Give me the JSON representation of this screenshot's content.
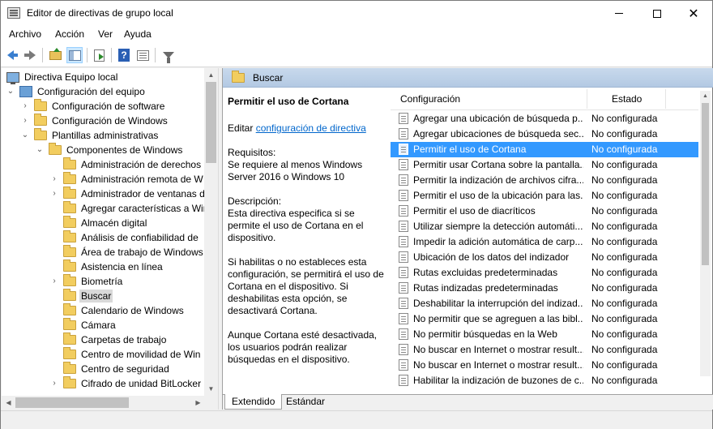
{
  "window": {
    "title": "Editor de directivas de grupo local",
    "controls": [
      "min",
      "max",
      "close"
    ]
  },
  "menu": [
    "Archivo",
    "Acción",
    "Ver",
    "Ayuda"
  ],
  "toolbar": {
    "icons": [
      "back-arrow-icon",
      "forward-arrow-icon",
      "folder-up-icon",
      "show-hide-tree-icon",
      "export-list-icon",
      "help-icon",
      "properties-icon",
      "filter-icon"
    ]
  },
  "tree": {
    "items": [
      {
        "label": "Directiva Equipo local",
        "level": 0,
        "icon": "computer-policy-icon",
        "expander": ""
      },
      {
        "label": "Configuración del equipo",
        "level": 1,
        "icon": "computer-icon",
        "expander": "open"
      },
      {
        "label": "Configuración de software",
        "level": 2,
        "icon": "folder-icon",
        "expander": "closed"
      },
      {
        "label": "Configuración de Windows",
        "level": 2,
        "icon": "folder-icon",
        "expander": "closed"
      },
      {
        "label": "Plantillas administrativas",
        "level": 2,
        "icon": "folder-icon",
        "expander": "open"
      },
      {
        "label": "Componentes de Windows",
        "level": 3,
        "icon": "folder-icon",
        "expander": "open"
      },
      {
        "label": "Administración de derechos",
        "level": 4,
        "icon": "folder-icon",
        "expander": ""
      },
      {
        "label": "Administración remota de W",
        "level": 4,
        "icon": "folder-icon",
        "expander": "closed"
      },
      {
        "label": "Administrador de ventanas d",
        "level": 4,
        "icon": "folder-icon",
        "expander": "closed"
      },
      {
        "label": "Agregar características a Win",
        "level": 4,
        "icon": "folder-icon",
        "expander": ""
      },
      {
        "label": "Almacén digital",
        "level": 4,
        "icon": "folder-icon",
        "expander": ""
      },
      {
        "label": "Análisis de confiabilidad de",
        "level": 4,
        "icon": "folder-icon",
        "expander": ""
      },
      {
        "label": "Área de trabajo de Windows",
        "level": 4,
        "icon": "folder-icon",
        "expander": ""
      },
      {
        "label": "Asistencia en línea",
        "level": 4,
        "icon": "folder-icon",
        "expander": ""
      },
      {
        "label": "Biometría",
        "level": 4,
        "icon": "folder-icon",
        "expander": "closed"
      },
      {
        "label": "Buscar",
        "level": 4,
        "icon": "folder-icon",
        "expander": "",
        "selected": true
      },
      {
        "label": "Calendario de Windows",
        "level": 4,
        "icon": "folder-icon",
        "expander": ""
      },
      {
        "label": "Cámara",
        "level": 4,
        "icon": "folder-icon",
        "expander": ""
      },
      {
        "label": "Carpetas de trabajo",
        "level": 4,
        "icon": "folder-icon",
        "expander": ""
      },
      {
        "label": "Centro de movilidad de Win",
        "level": 4,
        "icon": "folder-icon",
        "expander": ""
      },
      {
        "label": "Centro de seguridad",
        "level": 4,
        "icon": "folder-icon",
        "expander": ""
      },
      {
        "label": "Cifrado de unidad BitLocker",
        "level": 4,
        "icon": "folder-icon",
        "expander": "closed"
      }
    ]
  },
  "right": {
    "header": "Buscar",
    "description": {
      "title": "Permitir el uso de Cortana",
      "edit_prefix": "Editar ",
      "edit_link": "configuración de directiva",
      "requirements_label": "Requisitos:",
      "requirements_text": "Se requiere al menos Windows Server 2016 o Windows 10",
      "description_label": "Descripción:",
      "description_text": "Esta directiva especifica si se permite el uso de Cortana en el dispositivo.",
      "para1": "Si habilitas o no estableces esta configuración, se permitirá el uso de Cortana en el dispositivo. Si deshabilitas esta opción, se desactivará Cortana.",
      "para2": "Aunque Cortana esté desactivada, los usuarios podrán realizar búsquedas en el dispositivo."
    },
    "columns": {
      "config": "Configuración",
      "state": "Estado"
    },
    "rows": [
      {
        "name": "Agregar una ubicación de búsqueda p...",
        "state": "No configurada"
      },
      {
        "name": "Agregar ubicaciones de búsqueda sec...",
        "state": "No configurada"
      },
      {
        "name": "Permitir el uso de Cortana",
        "state": "No configurada",
        "selected": true
      },
      {
        "name": "Permitir usar Cortana sobre la pantalla...",
        "state": "No configurada"
      },
      {
        "name": "Permitir la indización de archivos cifra...",
        "state": "No configurada"
      },
      {
        "name": "Permitir el uso de la ubicación para las...",
        "state": "No configurada"
      },
      {
        "name": "Permitir el uso de diacríticos",
        "state": "No configurada"
      },
      {
        "name": "Utilizar siempre la detección automáti...",
        "state": "No configurada"
      },
      {
        "name": "Impedir la adición automática de carp...",
        "state": "No configurada"
      },
      {
        "name": "Ubicación de los datos del indizador",
        "state": "No configurada"
      },
      {
        "name": "Rutas excluidas predeterminadas",
        "state": "No configurada"
      },
      {
        "name": "Rutas indizadas predeterminadas",
        "state": "No configurada"
      },
      {
        "name": "Deshabilitar la interrupción del indizad...",
        "state": "No configurada"
      },
      {
        "name": "No permitir que se agreguen a las bibl...",
        "state": "No configurada"
      },
      {
        "name": "No permitir búsquedas en la Web",
        "state": "No configurada"
      },
      {
        "name": "No buscar en Internet o mostrar result...",
        "state": "No configurada"
      },
      {
        "name": "No buscar en Internet o mostrar result...",
        "state": "No configurada"
      },
      {
        "name": "Habilitar la indización de buzones de c...",
        "state": "No configurada"
      }
    ],
    "tabs": [
      "Extendido",
      "Estándar"
    ]
  }
}
